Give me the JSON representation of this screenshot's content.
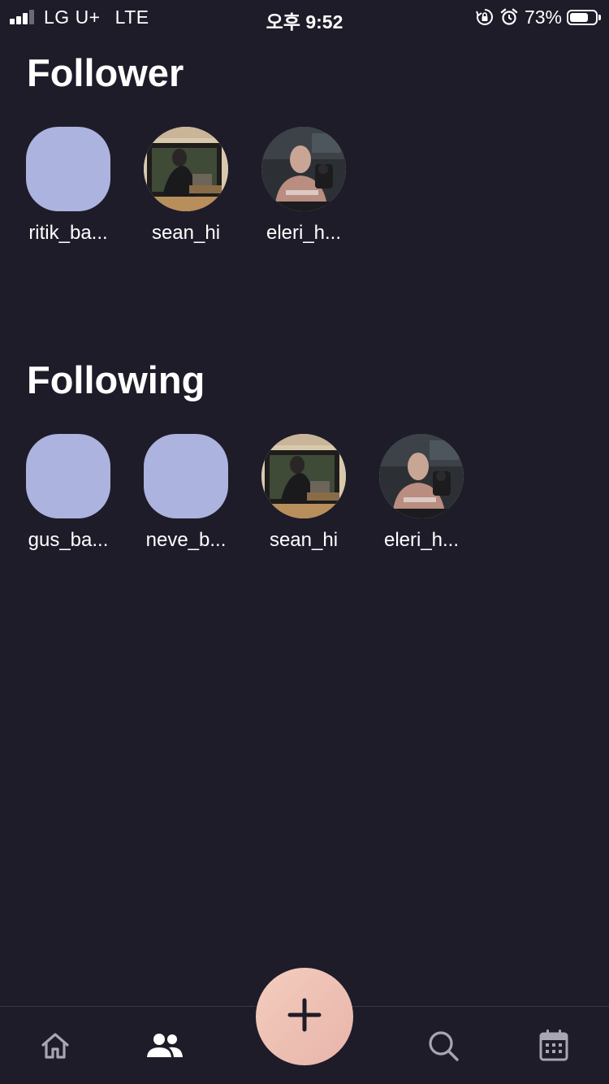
{
  "status_bar": {
    "carrier": "LG U+",
    "network": "LTE",
    "time": "오후 9:52",
    "battery_percent": "73%",
    "battery_level": 0.73
  },
  "follower": {
    "title": "Follower",
    "users": [
      {
        "name": "ritik_ba...",
        "avatar": "placeholder"
      },
      {
        "name": "sean_hi",
        "avatar": "photo-room"
      },
      {
        "name": "eleri_h...",
        "avatar": "photo-man"
      }
    ]
  },
  "following": {
    "title": "Following",
    "users": [
      {
        "name": "gus_ba...",
        "avatar": "placeholder"
      },
      {
        "name": "neve_b...",
        "avatar": "placeholder"
      },
      {
        "name": "sean_hi",
        "avatar": "photo-room"
      },
      {
        "name": "eleri_h...",
        "avatar": "photo-man"
      }
    ]
  },
  "bottom_nav": {
    "items": [
      {
        "icon": "home-icon",
        "active": false
      },
      {
        "icon": "people-icon",
        "active": true
      },
      {
        "icon": "plus-icon",
        "active": false
      },
      {
        "icon": "search-icon",
        "active": false
      },
      {
        "icon": "calendar-icon",
        "active": false
      }
    ]
  },
  "colors": {
    "background": "#1e1c29",
    "avatar_placeholder": "#adb3df",
    "fab_gradient_start": "#f3cdbd",
    "fab_gradient_end": "#e8b4ab",
    "nav_inactive": "#a8a6b3"
  }
}
